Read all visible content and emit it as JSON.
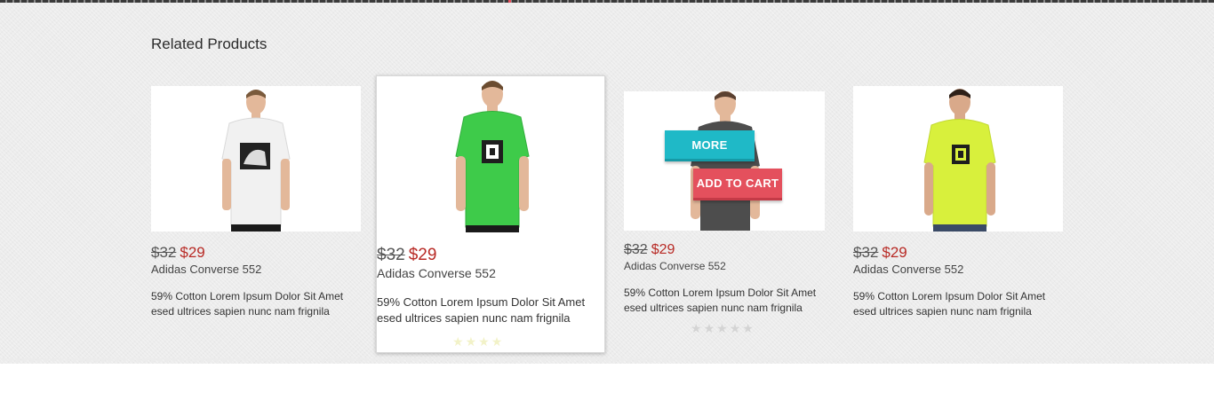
{
  "section": {
    "title": "Related Products"
  },
  "colors": {
    "new_price": "#b82a25",
    "more_button": "#1fb9c7",
    "cart_button": "#e4505d",
    "shirt_white": "#f1f1f1",
    "shirt_green": "#3ecb4a",
    "shirt_dark": "#4d4d4d",
    "shirt_lime": "#d8f03c"
  },
  "products": [
    {
      "old_price": "$32",
      "new_price": "$29",
      "name": "Adidas Converse 552",
      "description": "59% Cotton Lorem Ipsum Dolor Sit Amet esed ultrices sapien nunc nam frignila",
      "image_icon": "white-tshirt-model-photo"
    },
    {
      "old_price": "$32",
      "new_price": "$29",
      "name": "Adidas Converse 552",
      "description": "59% Cotton Lorem Ipsum Dolor Sit Amet esed ultrices sapien nunc nam frignila",
      "image_icon": "green-tshirt-model-photo",
      "stars": [
        "★",
        "★",
        "★",
        "★",
        "★"
      ]
    },
    {
      "old_price": "$32",
      "new_price": "$29",
      "name": "Adidas Converse 552",
      "description": "59% Cotton Lorem Ipsum Dolor Sit Amet esed ultrices sapien nunc nam frignila",
      "image_icon": "dark-tshirt-model-photo",
      "more_label": "MORE",
      "cart_label": "ADD TO CART",
      "stars": [
        "★",
        "★",
        "★",
        "★",
        "★"
      ]
    },
    {
      "old_price": "$32",
      "new_price": "$29",
      "name": "Adidas Converse 552",
      "description": "59% Cotton Lorem Ipsum Dolor Sit Amet esed ultrices sapien nunc nam frignila",
      "image_icon": "lime-tshirt-model-photo"
    }
  ]
}
